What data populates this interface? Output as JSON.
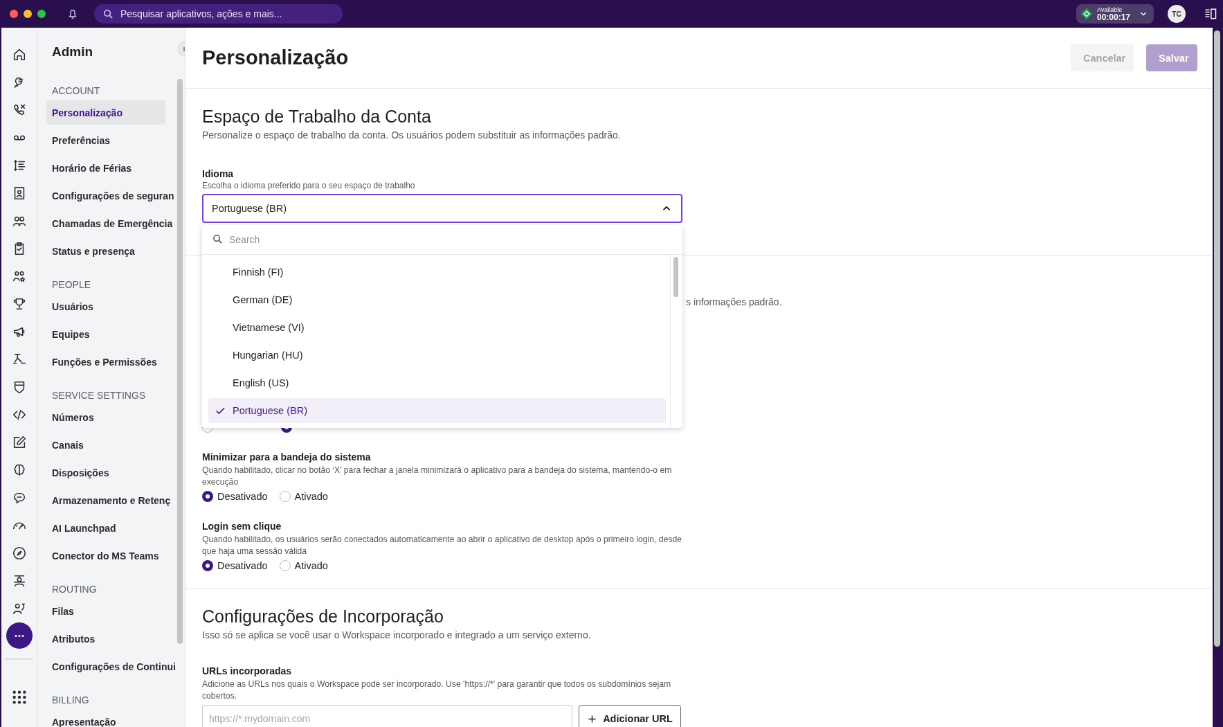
{
  "topbar": {
    "search": {
      "placeholder": "Pesquisar aplicativos, ações e mais..."
    },
    "status": {
      "label": "Available",
      "timer": "00:00:17"
    },
    "avatar": "TC"
  },
  "sidebar": {
    "title": "Admin",
    "groups": [
      {
        "heading": "ACCOUNT",
        "items": [
          {
            "label": "Personalização",
            "selected": true
          },
          {
            "label": "Preferências",
            "selected": false
          },
          {
            "label": "Horário de Férias",
            "selected": false
          },
          {
            "label": "Configurações de seguran",
            "selected": false
          },
          {
            "label": "Chamadas de Emergência",
            "selected": false
          },
          {
            "label": "Status e presença",
            "selected": false
          }
        ]
      },
      {
        "heading": "PEOPLE",
        "items": [
          {
            "label": "Usuários",
            "selected": false
          },
          {
            "label": "Equipes",
            "selected": false
          },
          {
            "label": "Funções e Permissões",
            "selected": false
          }
        ]
      },
      {
        "heading": "SERVICE SETTINGS",
        "items": [
          {
            "label": "Números",
            "selected": false
          },
          {
            "label": "Canais",
            "selected": false
          },
          {
            "label": "Disposições",
            "selected": false
          },
          {
            "label": "Armazenamento e Retenç",
            "selected": false
          },
          {
            "label": "AI Launchpad",
            "selected": false
          },
          {
            "label": "Conector do MS Teams",
            "selected": false
          }
        ]
      },
      {
        "heading": "ROUTING",
        "items": [
          {
            "label": "Filas",
            "selected": false
          },
          {
            "label": "Atributos",
            "selected": false
          },
          {
            "label": "Configurações de Continui",
            "selected": false
          }
        ]
      },
      {
        "heading": "BILLING",
        "items": [
          {
            "label": "Apresentação",
            "selected": false
          }
        ]
      }
    ]
  },
  "header": {
    "title": "Personalização",
    "buttons": [
      {
        "label": "Cancelar",
        "kind": "secondary",
        "disabled": true
      },
      {
        "label": "Salvar",
        "kind": "primary",
        "disabled": true
      }
    ]
  },
  "workspace": {
    "title": "Espaço de Trabalho da Conta",
    "description": "Personalize o espaço de trabalho da conta. Os usuários podem substituir as informações padrão.",
    "language": {
      "label": "Idioma",
      "hint": "Escolha o idioma preferido para o seu espaço de trabalho",
      "value": "Portuguese (BR)",
      "expanded": true,
      "search_placeholder": "Search",
      "options": [
        {
          "label": "Finnish (FI)",
          "selected": false
        },
        {
          "label": "German (DE)",
          "selected": false
        },
        {
          "label": "Vietnamese (VI)",
          "selected": false
        },
        {
          "label": "Hungarian (HU)",
          "selected": false
        },
        {
          "label": "English (US)",
          "selected": false
        },
        {
          "label": "Portuguese (BR)",
          "selected": true
        }
      ]
    }
  },
  "covered_section": {
    "description": "s informações padrão.",
    "options": [
      {
        "selected": false
      },
      {
        "selected": true
      }
    ]
  },
  "settings": [
    {
      "label": "Minimizar para a bandeja do sistema",
      "description": "Quando habilitado, clicar no botão ‘X’ para fechar a janela minimizará o aplicativo para a bandeja do sistema, mantendo-o em execução",
      "options": [
        {
          "label": "Desativado",
          "selected": true
        },
        {
          "label": "Ativado",
          "selected": false
        }
      ]
    },
    {
      "label": "Login sem clique",
      "description": "Quando habilitado, os usuários serão conectados automaticamente ao abrir o aplicativo de desktop após o primeiro login, desde que haja uma sessão válida",
      "options": [
        {
          "label": "Desativado",
          "selected": true
        },
        {
          "label": "Ativado",
          "selected": false
        }
      ]
    }
  ],
  "embed": {
    "title": "Configurações de Incorporação",
    "description": "Isso só se aplica se você usar o Workspace incorporado e integrado a um serviço externo.",
    "urls": {
      "label": "URLs incorporadas",
      "description": "Adicione as URLs nos quais o Workspace pode ser incorporado. Use 'https://*' para garantir que todos os subdomínios sejam cobertos.",
      "placeholder": "https://*.mydomain.com",
      "button": "Adicionar URL"
    }
  }
}
